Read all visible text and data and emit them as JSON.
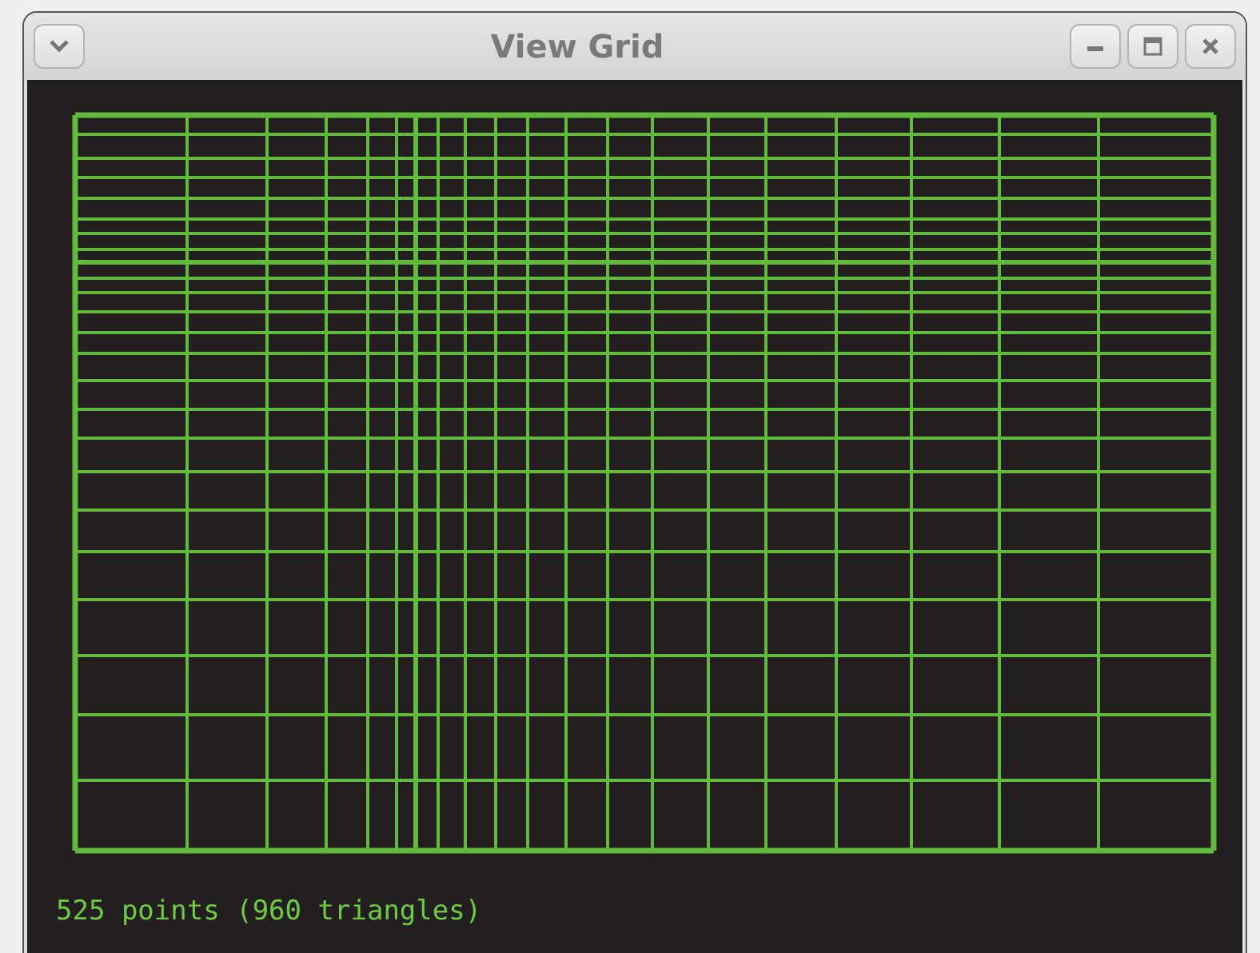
{
  "window": {
    "title": "View Grid"
  },
  "status": "525 points (960 triangles)"
}
